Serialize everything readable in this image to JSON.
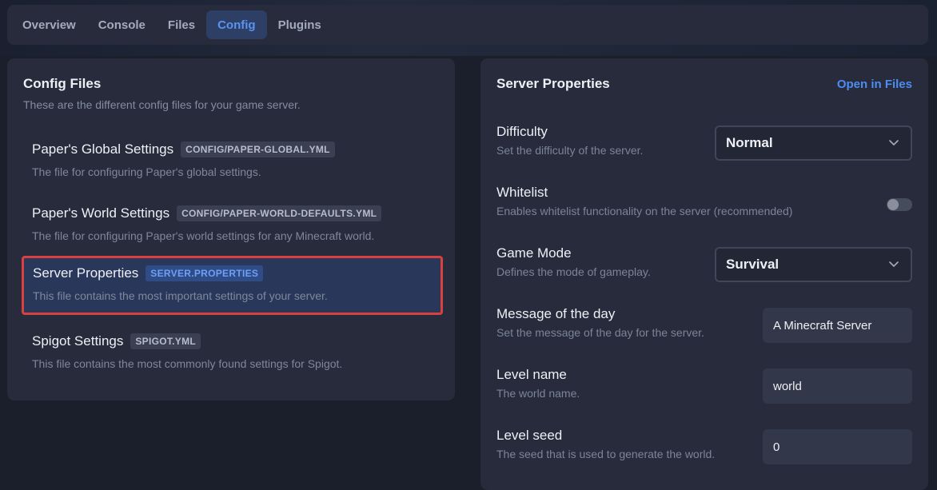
{
  "tabs": [
    {
      "label": "Overview"
    },
    {
      "label": "Console"
    },
    {
      "label": "Files"
    },
    {
      "label": "Config"
    },
    {
      "label": "Plugins"
    }
  ],
  "active_tab": "Config",
  "config_files": {
    "title": "Config Files",
    "subtitle": "These are the different config files for your game server.",
    "items": [
      {
        "name": "Paper's Global Settings",
        "badge": "CONFIG/PAPER-GLOBAL.YML",
        "description": "The file for configuring Paper's global settings."
      },
      {
        "name": "Paper's World Settings",
        "badge": "CONFIG/PAPER-WORLD-DEFAULTS.YML",
        "description": "The file for configuring Paper's world settings for any Minecraft world."
      },
      {
        "name": "Server Properties",
        "badge": "SERVER.PROPERTIES",
        "description": "This file contains the most important settings of your server."
      },
      {
        "name": "Spigot Settings",
        "badge": "SPIGOT.YML",
        "description": "This file contains the most commonly found settings for Spigot."
      }
    ]
  },
  "server_properties": {
    "title": "Server Properties",
    "open_link": "Open in Files",
    "difficulty": {
      "label": "Difficulty",
      "description": "Set the difficulty of the server.",
      "value": "Normal"
    },
    "whitelist": {
      "label": "Whitelist",
      "description": "Enables whitelist functionality on the server (recommended)",
      "enabled": false
    },
    "game_mode": {
      "label": "Game Mode",
      "description": "Defines the mode of gameplay.",
      "value": "Survival"
    },
    "motd": {
      "label": "Message of the day",
      "description": "Set the message of the day for the server.",
      "value": "A Minecraft Server"
    },
    "level_name": {
      "label": "Level name",
      "description": "The world name.",
      "value": "world"
    },
    "level_seed": {
      "label": "Level seed",
      "description": "The seed that is used to generate the world.",
      "value": "0"
    }
  },
  "colors": {
    "accent": "#4d8df2",
    "selection_border": "#d9403f",
    "card_bg": "#272b3b",
    "page_bg": "#1b1f2c"
  }
}
